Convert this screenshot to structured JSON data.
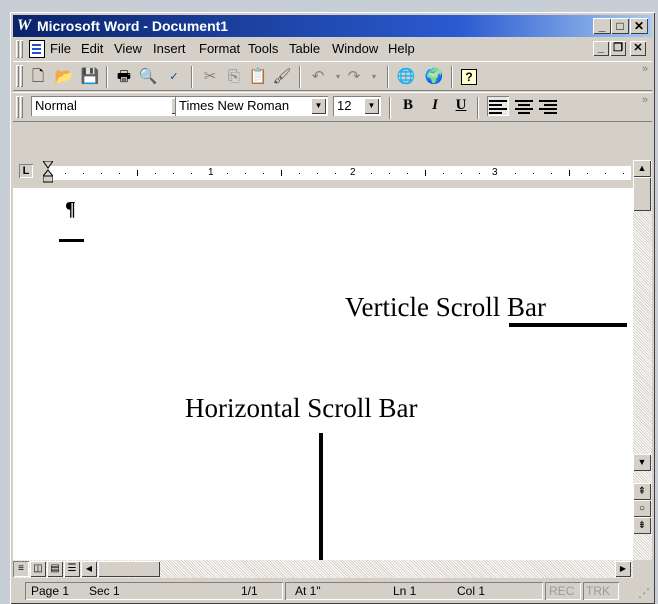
{
  "window": {
    "title": "Microsoft Word - Document1",
    "app_icon_glyph": "W"
  },
  "menubar": {
    "items": [
      "File",
      "Edit",
      "View",
      "Insert",
      "Format",
      "Tools",
      "Table",
      "Window",
      "Help"
    ]
  },
  "toolbar_standard": {
    "icons": [
      "new-document-icon",
      "open-folder-icon",
      "save-icon",
      "print-icon",
      "print-preview-icon",
      "spelling-icon",
      "cut-icon",
      "copy-icon",
      "paste-icon",
      "format-painter-icon",
      "undo-icon",
      "redo-icon",
      "web-toolbar-icon",
      "insert-hyperlink-icon",
      "help-icon"
    ]
  },
  "toolbar_formatting": {
    "style_value": "Normal",
    "font_value": "Times New Roman",
    "size_value": "12",
    "bold_label": "B",
    "italic_label": "I",
    "underline_label": "U"
  },
  "ruler": {
    "numbers": [
      "1",
      "2",
      "3"
    ]
  },
  "document": {
    "pilcrow": "¶",
    "annotation_vertical": "Verticle Scroll Bar",
    "annotation_horizontal": "Horizontal Scroll Bar"
  },
  "statusbar": {
    "page": "Page 1",
    "sec": "Sec 1",
    "pages": "1/1",
    "at": "At 1\"",
    "ln": "Ln 1",
    "col": "Col 1",
    "rec": "REC",
    "trk": "TRK"
  },
  "colors": {
    "titlebar_start": "#0a246a",
    "titlebar_end": "#a6caf0",
    "chrome": "#d4d0c8"
  }
}
